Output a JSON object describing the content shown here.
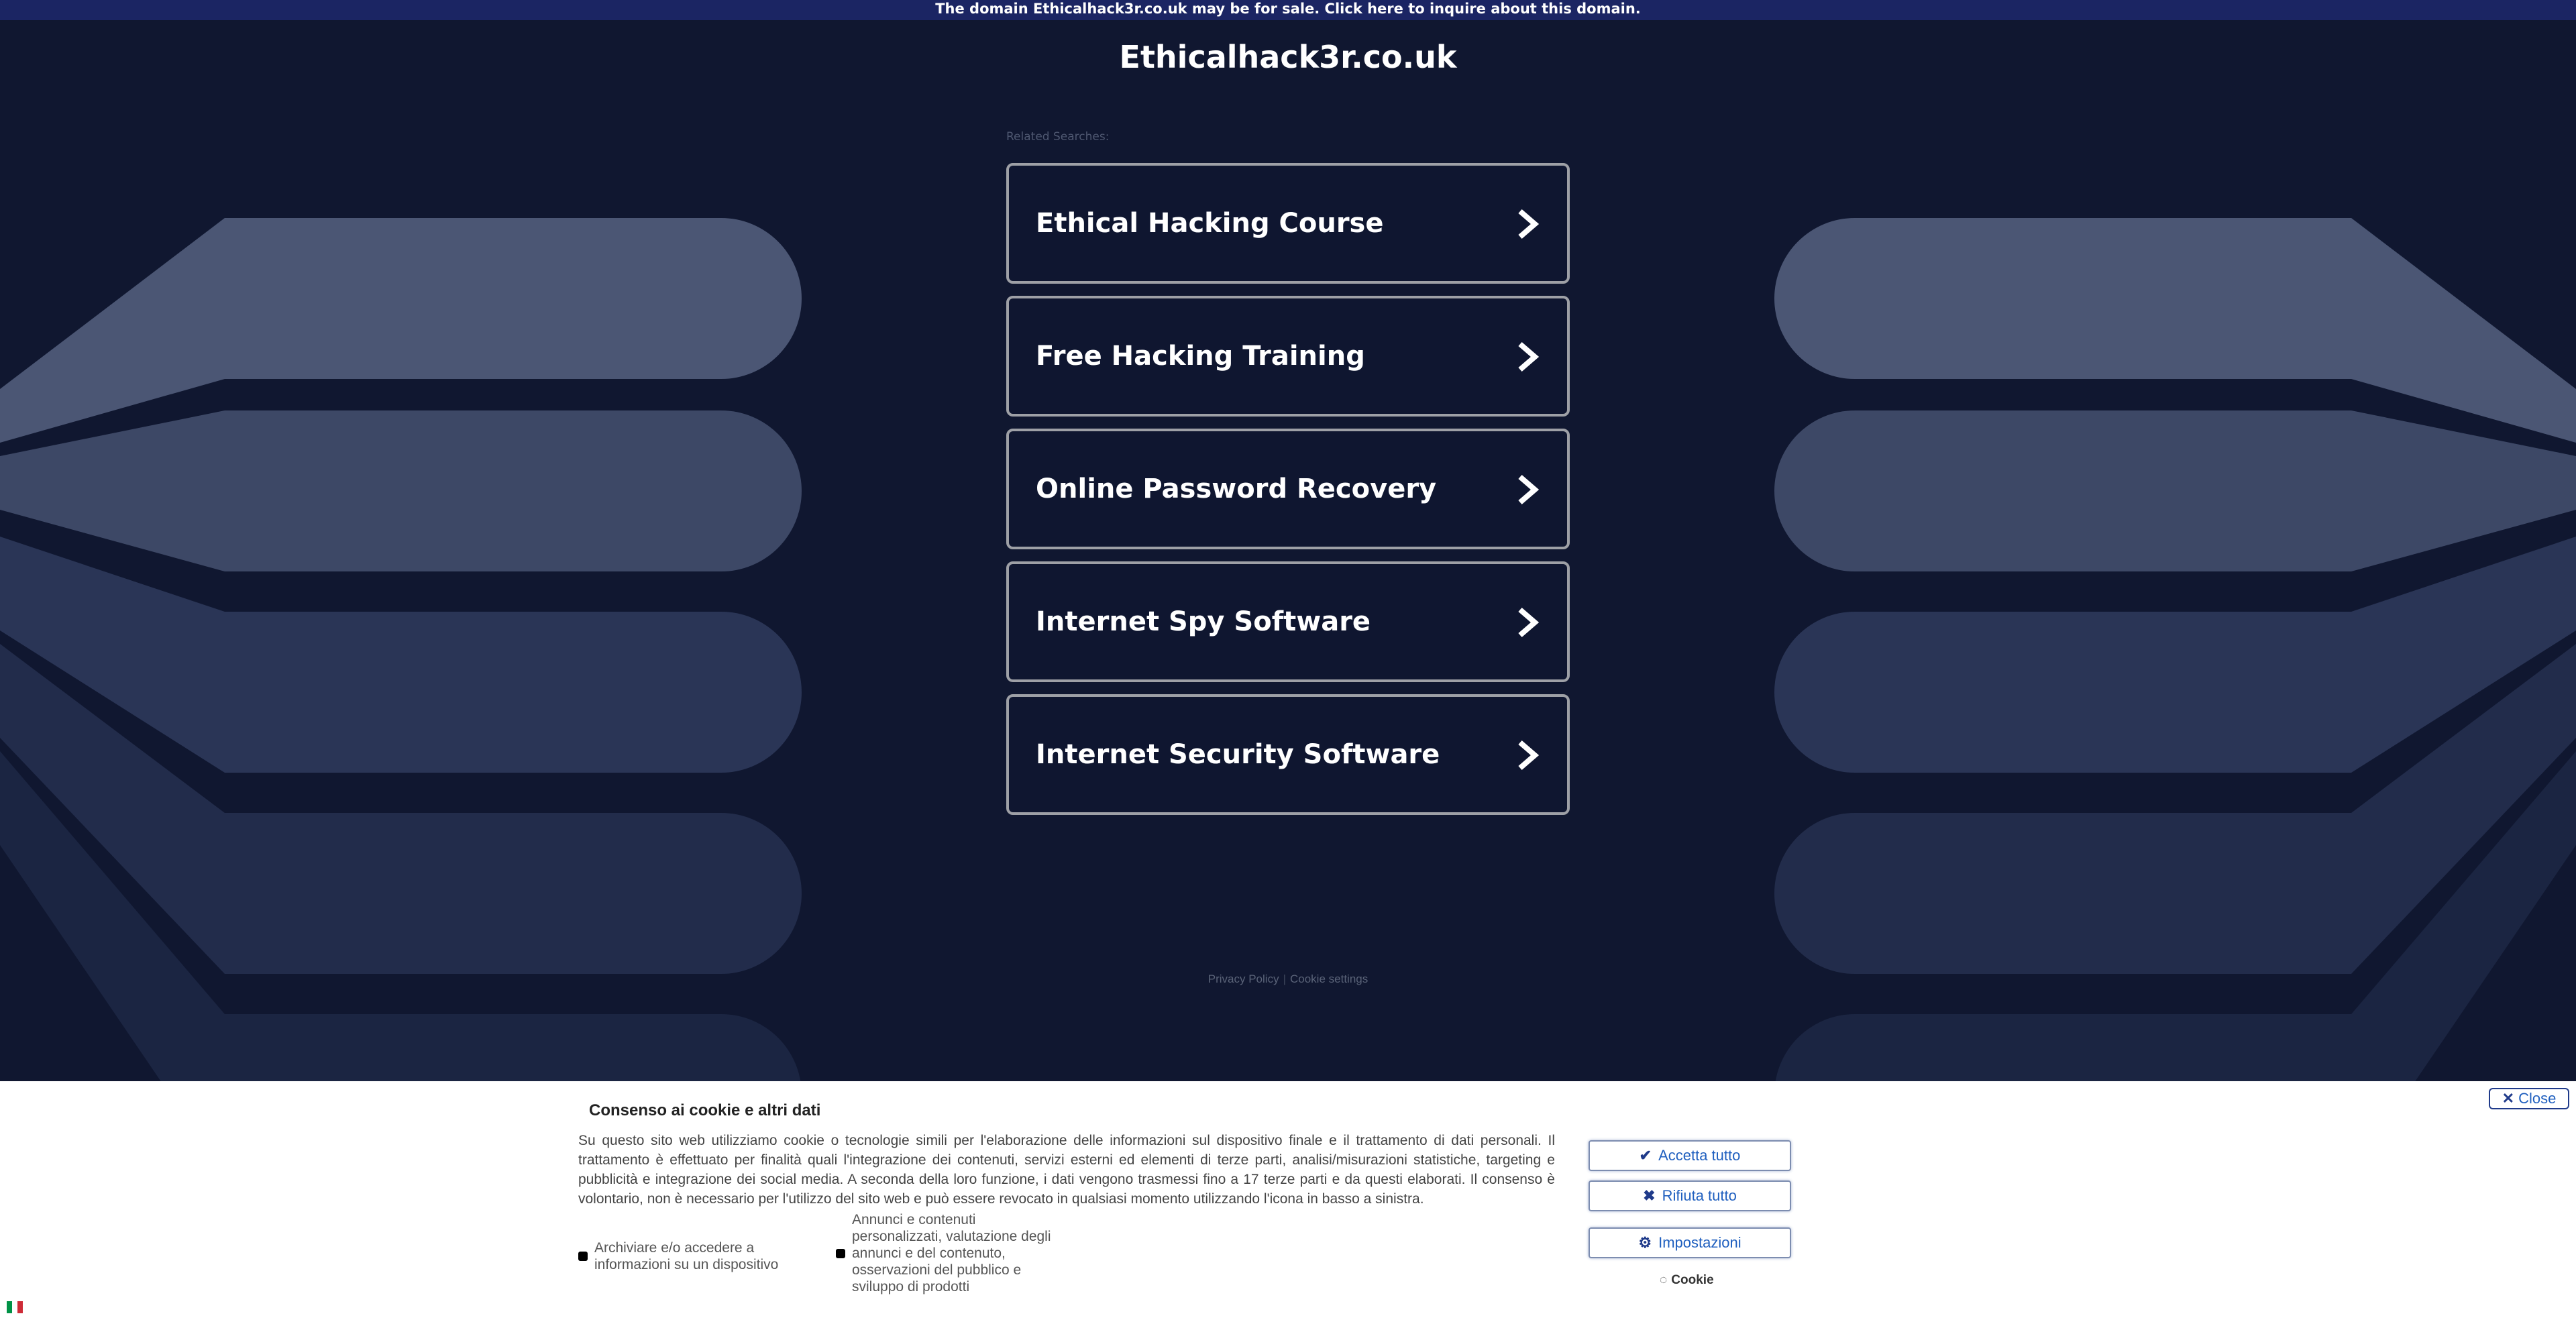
{
  "topbar": {
    "text": "The domain Ethicalhack3r.co.uk may be for sale. Click here to inquire about this domain."
  },
  "site": {
    "title": "Ethicalhack3r.co.uk"
  },
  "related": {
    "label": "Related Searches:",
    "items": [
      {
        "label": "Ethical Hacking Course"
      },
      {
        "label": "Free Hacking Training"
      },
      {
        "label": "Online Password Recovery"
      },
      {
        "label": "Internet Spy Software"
      },
      {
        "label": "Internet Security Software"
      }
    ]
  },
  "footer": {
    "privacy": "Privacy Policy",
    "separator": "|",
    "cookie_settings": "Cookie settings"
  },
  "cookie": {
    "close_label": "Close",
    "title": "Consenso ai cookie e altri dati",
    "text": "Su questo sito web utilizziamo cookie o tecnologie simili per l'elaborazione delle informazioni sul dispositivo finale e il trattamento di dati personali. Il trattamento è effettuato per finalità quali l'integrazione dei contenuti, servizi esterni ed elementi di terze parti, analisi/misurazioni statistiche, targeting e pubblicità e integrazione dei social media. A seconda della loro funzione, i dati vengono trasmessi fino a 17 terze parti e da questi elaborati. Il consenso è volontario, non è necessario per l'utilizzo del sito web e può essere revocato in qualsiasi momento utilizzando l'icona in basso a sinistra.",
    "purposes": [
      {
        "label": "Archiviare e/o accedere a informazioni su un dispositivo"
      },
      {
        "label": "Annunci e contenuti personalizzati, valutazione degli annunci e del contenuto, osservazioni del pubblico e sviluppo di prodotti"
      }
    ],
    "accept_label": "Accetta tutto",
    "reject_label": "Rifiuta tutto",
    "settings_label": "Impostazioni",
    "cookie_link": "Cookie"
  },
  "colors": {
    "background": "#101730",
    "topbar": "#1b2563",
    "button_text": "#1f5fbf"
  },
  "icons": [
    "chevron-right-icon",
    "check-icon",
    "x-icon",
    "gear-icon",
    "cookie-icon",
    "italy-flag-icon"
  ]
}
